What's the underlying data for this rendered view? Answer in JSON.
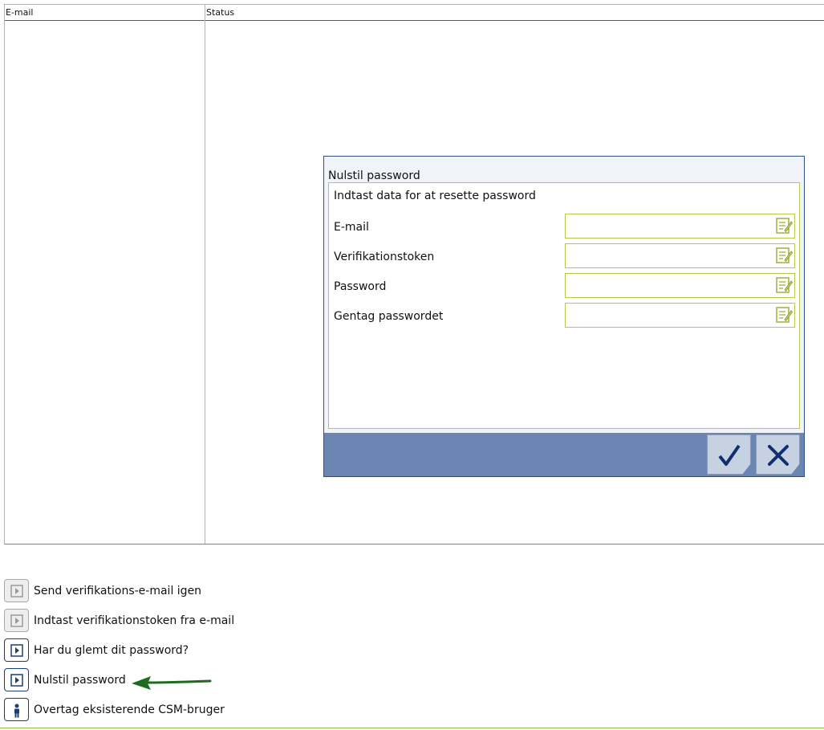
{
  "table": {
    "columns": [
      "E-mail",
      "Status"
    ]
  },
  "dialog": {
    "title": "Nulstil password",
    "intro": "Indtast data for at resette password",
    "fields": [
      {
        "label": "E-mail",
        "value": ""
      },
      {
        "label": "Verifikationstoken",
        "value": ""
      },
      {
        "label": "Password",
        "value": ""
      },
      {
        "label": "Gentag passwordet",
        "value": ""
      }
    ],
    "buttons": {
      "confirm_icon": "check-icon",
      "cancel_icon": "close-icon"
    }
  },
  "actions": [
    {
      "label": "Send verifikations-e-mail igen",
      "icon": "play-icon",
      "enabled": false
    },
    {
      "label": "Indtast verifikationstoken fra e-mail",
      "icon": "play-icon",
      "enabled": false
    },
    {
      "label": "Har du glemt dit password?",
      "icon": "play-icon",
      "enabled": true
    },
    {
      "label": "Nulstil password",
      "icon": "play-icon",
      "enabled": true
    },
    {
      "label": "Overtag eksisterende CSM-bruger",
      "icon": "person-icon",
      "enabled": true
    }
  ],
  "annotation": {
    "arrow_color": "#1e6b1e",
    "points_to": "Nulstil password"
  },
  "colors": {
    "accent_blue": "#1c3f77",
    "footer_blue": "#6b86b3",
    "border_green": "#b8c84a"
  }
}
